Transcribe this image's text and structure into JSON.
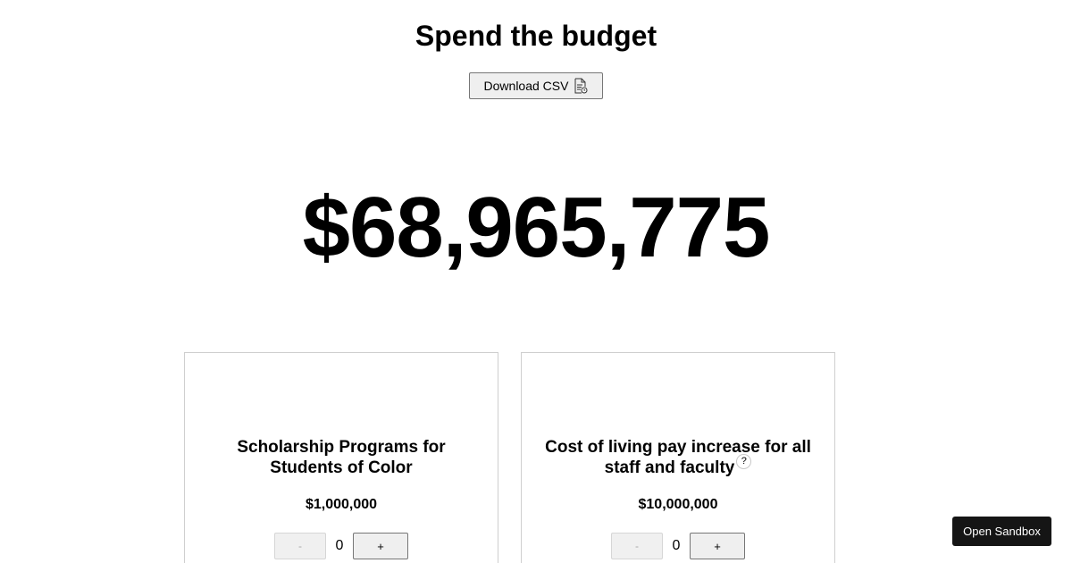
{
  "header": {
    "title": "Spend the budget",
    "download_label": "Download CSV",
    "download_icon": "csv-file-icon"
  },
  "total": {
    "amount": "$68,965,775"
  },
  "cards": [
    {
      "title": "Scholarship Programs for Students of Color",
      "price": "$1,000,000",
      "minus_label": "-",
      "quantity": "0",
      "plus_label": "+",
      "minus_disabled": true
    },
    {
      "title": "Cost of living pay increase for all staff and faculty",
      "help_label": "?",
      "price": "$10,000,000",
      "minus_label": "-",
      "quantity": "0",
      "plus_label": "+",
      "minus_disabled": true
    }
  ],
  "sandbox": {
    "label": "Open Sandbox"
  }
}
